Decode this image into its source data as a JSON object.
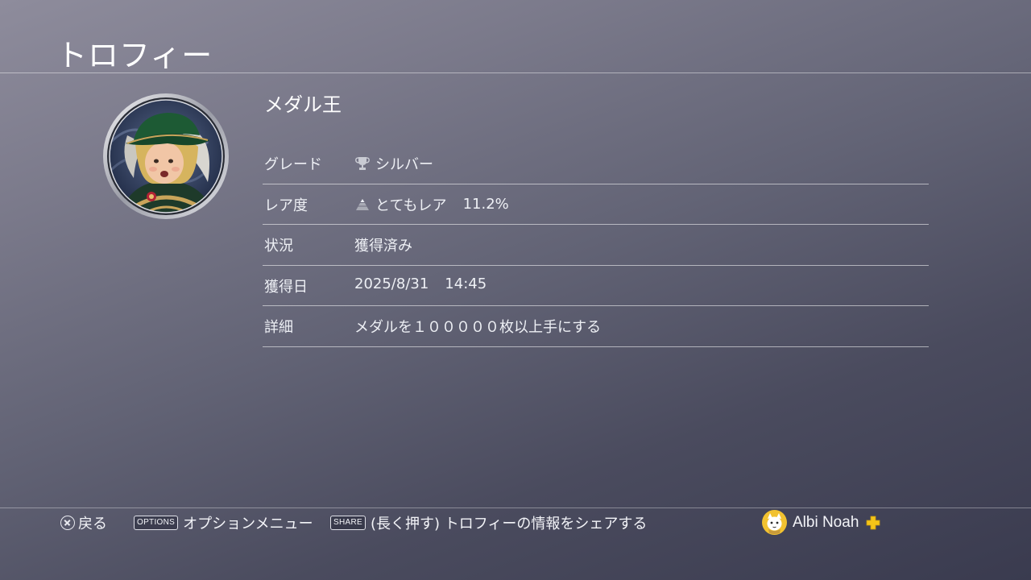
{
  "header": {
    "title": "トロフィー"
  },
  "trophy": {
    "name": "メダル王",
    "image_icon": "trophy-character-portrait"
  },
  "details": {
    "grade_label": "グレード",
    "grade_value": "シルバー",
    "grade_icon": "silver-trophy-icon",
    "rarity_label": "レア度",
    "rarity_value": "とてもレア",
    "rarity_percent": "11.2%",
    "rarity_icon": "rarity-pyramid-icon",
    "status_label": "状況",
    "status_value": "獲得済み",
    "date_label": "獲得日",
    "date_value": "2025/8/31",
    "time_value": "14:45",
    "description_label": "詳細",
    "description_value": "メダルを１０００００枚以上手にする"
  },
  "footer": {
    "back_label": "戻る",
    "options_key": "OPTIONS",
    "options_label": "オプションメニュー",
    "share_key": "SHARE",
    "share_label": "(長く押す) トロフィーの情報をシェアする",
    "user_name": "Albi Noah"
  },
  "colors": {
    "plus_gold": "#f5c518",
    "silver": "#c9cbd3"
  }
}
